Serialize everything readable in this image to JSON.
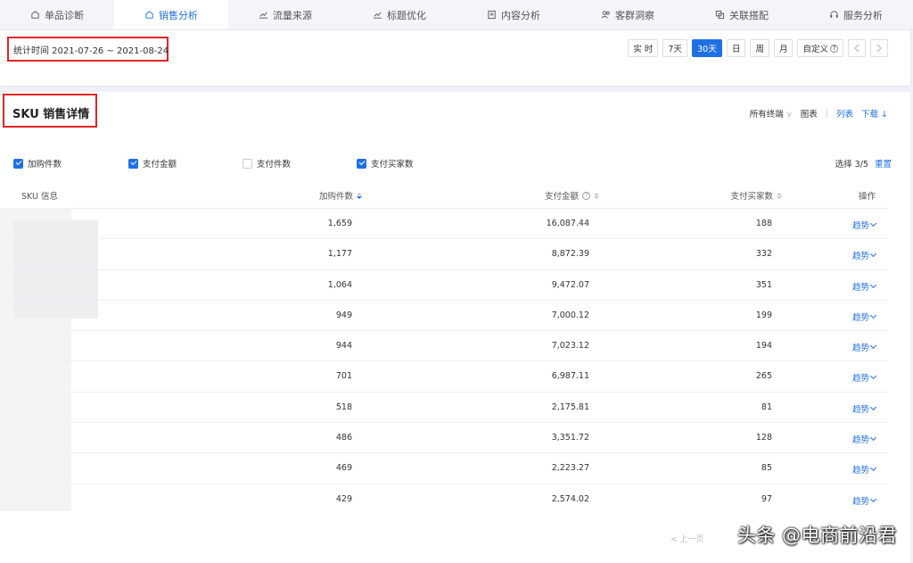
{
  "tabs": [
    {
      "label": "单品诊断",
      "icon": "home-icon",
      "active": false
    },
    {
      "label": "销售分析",
      "icon": "home-icon",
      "active": true
    },
    {
      "label": "流量来源",
      "icon": "line-chart-icon",
      "active": false
    },
    {
      "label": "标题优化",
      "icon": "line-chart-icon",
      "active": false
    },
    {
      "label": "内容分析",
      "icon": "document-icon",
      "active": false
    },
    {
      "label": "客群洞察",
      "icon": "users-icon",
      "active": false
    },
    {
      "label": "关联搭配",
      "icon": "link-icon",
      "active": false
    },
    {
      "label": "服务分析",
      "icon": "headset-icon",
      "active": false
    }
  ],
  "date_range": "统计时间 2021-07-26 ~ 2021-08-24",
  "periods": [
    {
      "label": "实 时",
      "active": false
    },
    {
      "label": "7天",
      "active": false
    },
    {
      "label": "30天",
      "active": true
    },
    {
      "label": "日",
      "active": false
    },
    {
      "label": "周",
      "active": false
    },
    {
      "label": "月",
      "active": false
    },
    {
      "label": "自定义",
      "active": false
    }
  ],
  "section": {
    "title": "SKU 销售详情",
    "terminal_filter": "所有终端",
    "view_chart": "图表",
    "view_list": "列表",
    "download": "下载"
  },
  "metrics": [
    {
      "label": "加购件数",
      "checked": true
    },
    {
      "label": "支付金额",
      "checked": true
    },
    {
      "label": "支付件数",
      "checked": false
    },
    {
      "label": "支付买家数",
      "checked": true
    }
  ],
  "selection": {
    "text": "选择 3/5",
    "reset": "重置"
  },
  "table": {
    "headers": {
      "sku": "SKU 信息",
      "cart": "加购件数",
      "amount": "支付金额",
      "buyers": "支付买家数",
      "action": "操作"
    },
    "rows": [
      {
        "cart": "1,659",
        "amount": "16,087.44",
        "buyers": "188",
        "action": "趋势"
      },
      {
        "cart": "1,177",
        "amount": "8,872.39",
        "buyers": "332",
        "action": "趋势"
      },
      {
        "cart": "1,064",
        "amount": "9,472.07",
        "buyers": "351",
        "action": "趋势"
      },
      {
        "cart": "949",
        "amount": "7,000.12",
        "buyers": "199",
        "action": "趋势"
      },
      {
        "cart": "944",
        "amount": "7,023.12",
        "buyers": "194",
        "action": "趋势"
      },
      {
        "cart": "701",
        "amount": "6,987.11",
        "buyers": "265",
        "action": "趋势"
      },
      {
        "cart": "518",
        "amount": "2,175.81",
        "buyers": "81",
        "action": "趋势"
      },
      {
        "cart": "486",
        "amount": "3,351.72",
        "buyers": "128",
        "action": "趋势"
      },
      {
        "cart": "469",
        "amount": "2,223.27",
        "buyers": "85",
        "action": "趋势"
      },
      {
        "cart": "429",
        "amount": "2,574.02",
        "buyers": "97",
        "action": "趋势"
      }
    ]
  },
  "pager": {
    "prev": "< 上一页"
  },
  "watermark": "头条 @电商前沿君",
  "colors": {
    "accent": "#1f6fe5",
    "highlight_box": "#e32424"
  }
}
